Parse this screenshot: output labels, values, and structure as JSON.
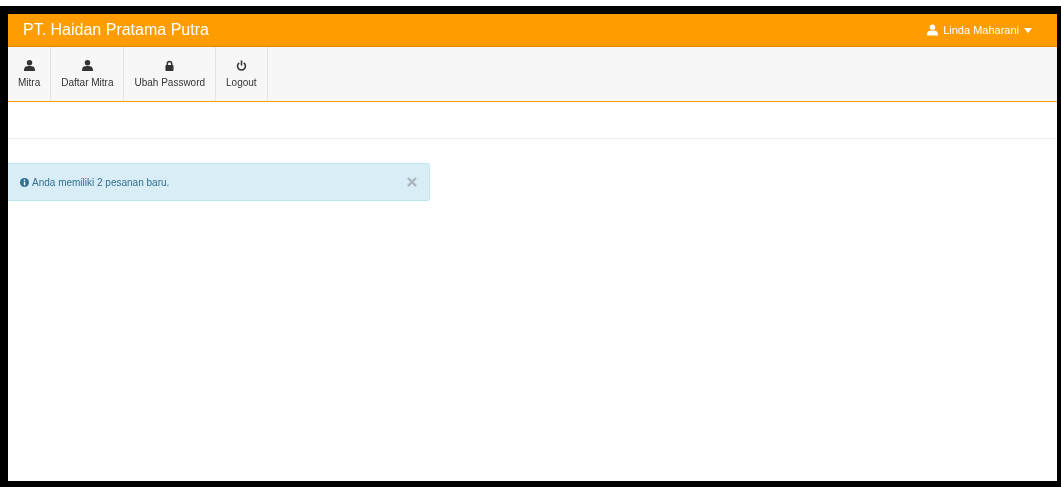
{
  "header": {
    "brand": "PT. Haidan Pratama Putra",
    "user": "Linda Maharani"
  },
  "toolbar": [
    {
      "label": "Mitra"
    },
    {
      "label": "Daftar Mitra"
    },
    {
      "label": "Ubah Password"
    },
    {
      "label": "Logout"
    }
  ],
  "alert": {
    "message": "Anda memiliki 2 pesanan baru."
  }
}
